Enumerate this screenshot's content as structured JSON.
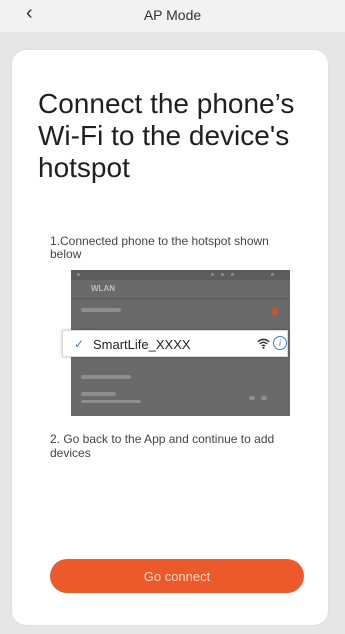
{
  "nav": {
    "title": "AP Mode",
    "back_icon": "back-chevron"
  },
  "heading": "Connect the phone’s Wi-Fi to the device's hotspot",
  "steps": [
    "1.Connected phone to the hotspot shown below",
    "2. Go back to the App and continue to add devices"
  ],
  "screenshot": {
    "list_title": "WLAN",
    "network_name": "SmartLife_XXXX"
  },
  "button": {
    "label": "Go connect",
    "color": "#ec5a2c"
  }
}
